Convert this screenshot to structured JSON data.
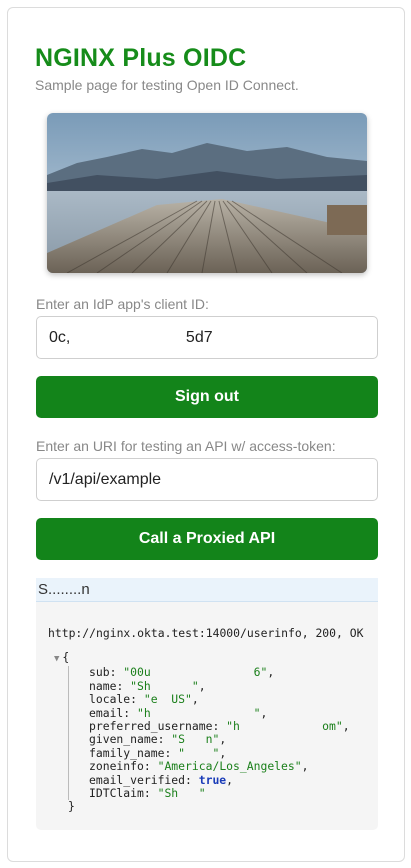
{
  "header": {
    "title": "NGINX Plus OIDC",
    "subtitle": "Sample page for testing Open ID Connect."
  },
  "hero_image": {
    "description_icon": "landscape-photo"
  },
  "client_id": {
    "label": "Enter an IdP app's client ID:",
    "value": "0c,                          5d7"
  },
  "sign_out": {
    "label": "Sign out"
  },
  "api": {
    "label": "Enter an URI for testing an API w/ access-token:",
    "value": "/v1/api/example",
    "button_label": "Call a Proxied API"
  },
  "user_tab": {
    "label": "S........n"
  },
  "response": {
    "status_line": "http://nginx.okta.test:14000/userinfo, 200, OK",
    "open_brace": "{",
    "close_brace": "}",
    "fields": [
      {
        "key": "sub",
        "value": "\"00u               6\"",
        "type": "string"
      },
      {
        "key": "name",
        "value": "\"Sh      \"",
        "type": "string"
      },
      {
        "key": "locale",
        "value": "\"e  US\"",
        "type": "string"
      },
      {
        "key": "email",
        "value": "\"h               \"",
        "type": "string"
      },
      {
        "key": "preferred_username",
        "value": "\"h            om\"",
        "type": "string"
      },
      {
        "key": "given_name",
        "value": "\"S   n\"",
        "type": "string"
      },
      {
        "key": "family_name",
        "value": "\"    \"",
        "type": "string"
      },
      {
        "key": "zoneinfo",
        "value": "\"America/Los_Angeles\"",
        "type": "string"
      },
      {
        "key": "email_verified",
        "value": "true",
        "type": "bool"
      },
      {
        "key": "IDTClaim",
        "value": "\"Sh   \"",
        "type": "string"
      }
    ]
  },
  "colors": {
    "brand_green": "#168c1a",
    "button_green": "#13841a",
    "tab_bg": "#eaf3fb",
    "code_bg": "#f5f5f5"
  }
}
